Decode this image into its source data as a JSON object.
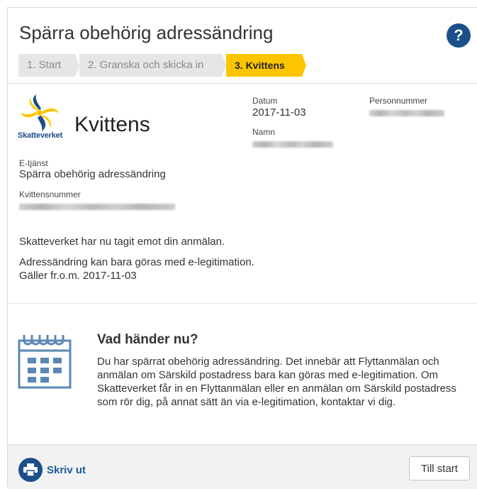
{
  "header": {
    "title": "Spärra obehörig adressändring",
    "help_label": "?",
    "steps": [
      {
        "label": "1.  Start"
      },
      {
        "label": "2.  Granska och skicka in"
      },
      {
        "label": "3.  Kvittens"
      }
    ]
  },
  "receipt": {
    "logo_text": "Skatteverket",
    "title": "Kvittens",
    "date_label": "Datum",
    "date_value": "2017-11-03",
    "personnummer_label": "Personnummer",
    "name_label": "Namn",
    "service_label": "E-tjänst",
    "service_value": "Spärra obehörig adressändring",
    "receipt_number_label": "Kvittensnummer",
    "messages": [
      "Skatteverket har nu tagit emot din anmälan.",
      "Adressändring kan bara göras med e-legitimation.",
      "Gäller fr.o.m. 2017-11-03"
    ]
  },
  "next": {
    "title": "Vad händer nu?",
    "text": "Du har spärrat obehörig adressändring. Det innebär att Flyttanmälan och anmälan om Särskild postadress bara kan göras med e-legitimation. Om Skatteverket får in en Flyttanmälan eller en anmälan om Särskild postadress som rör dig, på annat sätt än via e-legitimation, kontaktar vi dig."
  },
  "footer": {
    "print_label": "Skriv ut",
    "start_label": "Till start"
  },
  "colors": {
    "brand_blue": "#1b4f8a",
    "active_step": "#fdc500",
    "inactive_step": "#e6e6e6"
  },
  "icons": {
    "help": "question-icon",
    "logo": "skatteverket-logo-icon",
    "calendar": "calendar-icon",
    "print": "printer-icon"
  }
}
